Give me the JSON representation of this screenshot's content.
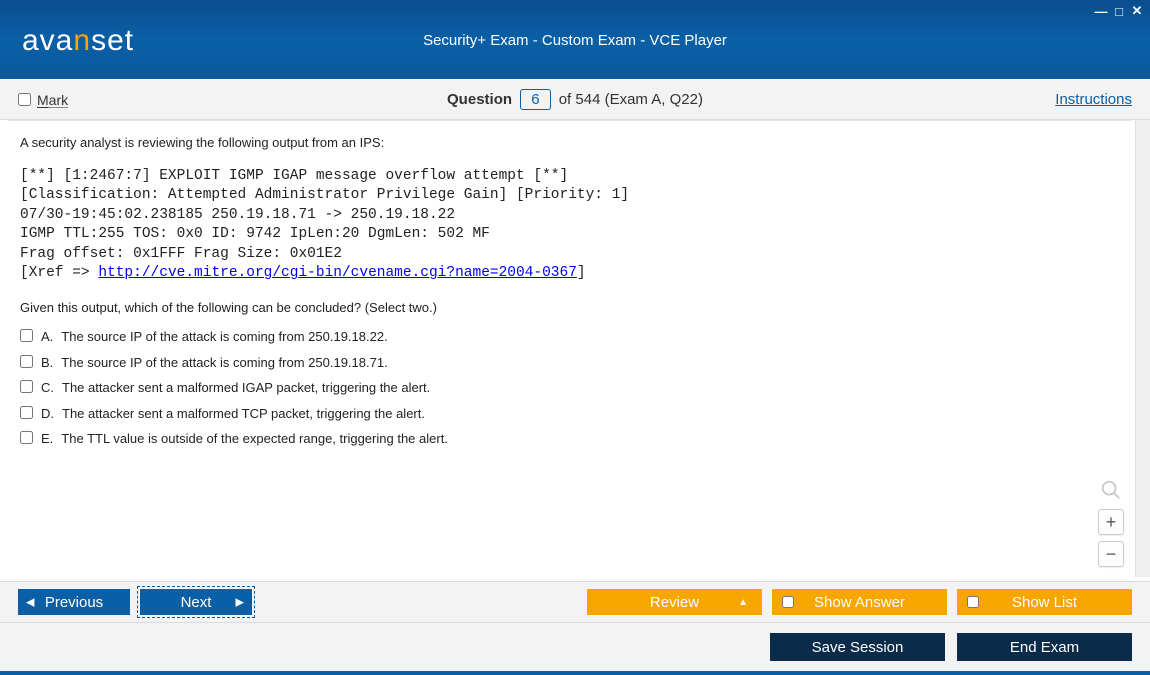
{
  "brand": {
    "pre": "ava",
    "accent": "n",
    "post": "set"
  },
  "window_title": "Security+ Exam - Custom Exam - VCE Player",
  "infobar": {
    "mark_label": "Mark",
    "question_word": "Question",
    "question_num": "6",
    "of_text": "of 544 (Exam A, Q22)",
    "instructions": "Instructions"
  },
  "question": {
    "prompt": "A security analyst is reviewing the following output from an IPS:",
    "mono_pre": "[**] [1:2467:7] EXPLOIT IGMP IGAP message overflow attempt [**]\n[Classification: Attempted Administrator Privilege Gain] [Priority: 1]\n07/30-19:45:02.238185 250.19.18.71 -> 250.19.18.22\nIGMP TTL:255 TOS: 0x0 ID: 9742 IpLen:20 DgmLen: 502 MF\nFrag offset: 0x1FFF Frag Size: 0x01E2\n[Xref => ",
    "mono_link": "http://cve.mitre.org/cgi-bin/cvename.cgi?name=2004-0367",
    "mono_post": "]",
    "subprompt": "Given this output, which of the following can be concluded? (Select two.)",
    "options": [
      {
        "letter": "A.",
        "text": "The source IP of the attack is coming from 250.19.18.22."
      },
      {
        "letter": "B.",
        "text": "The source IP of the attack is coming from 250.19.18.71."
      },
      {
        "letter": "C.",
        "text": "The attacker sent a malformed IGAP packet, triggering the alert."
      },
      {
        "letter": "D.",
        "text": "The attacker sent a malformed TCP packet, triggering the alert."
      },
      {
        "letter": "E.",
        "text": "The TTL value is outside of the expected range, triggering the alert."
      }
    ]
  },
  "nav": {
    "previous": "Previous",
    "next": "Next",
    "review": "Review",
    "show_answer": "Show Answer",
    "show_list": "Show List"
  },
  "bottom": {
    "save_session": "Save Session",
    "end_exam": "End Exam"
  }
}
